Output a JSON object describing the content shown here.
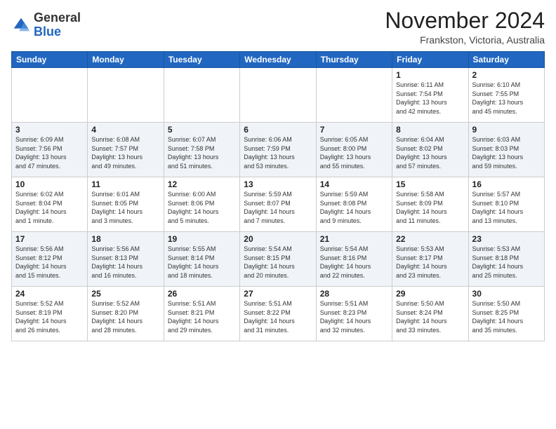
{
  "logo": {
    "general": "General",
    "blue": "Blue"
  },
  "header": {
    "month": "November 2024",
    "location": "Frankston, Victoria, Australia"
  },
  "weekdays": [
    "Sunday",
    "Monday",
    "Tuesday",
    "Wednesday",
    "Thursday",
    "Friday",
    "Saturday"
  ],
  "weeks": [
    [
      {
        "day": "",
        "info": ""
      },
      {
        "day": "",
        "info": ""
      },
      {
        "day": "",
        "info": ""
      },
      {
        "day": "",
        "info": ""
      },
      {
        "day": "",
        "info": ""
      },
      {
        "day": "1",
        "info": "Sunrise: 6:11 AM\nSunset: 7:54 PM\nDaylight: 13 hours\nand 42 minutes."
      },
      {
        "day": "2",
        "info": "Sunrise: 6:10 AM\nSunset: 7:55 PM\nDaylight: 13 hours\nand 45 minutes."
      }
    ],
    [
      {
        "day": "3",
        "info": "Sunrise: 6:09 AM\nSunset: 7:56 PM\nDaylight: 13 hours\nand 47 minutes."
      },
      {
        "day": "4",
        "info": "Sunrise: 6:08 AM\nSunset: 7:57 PM\nDaylight: 13 hours\nand 49 minutes."
      },
      {
        "day": "5",
        "info": "Sunrise: 6:07 AM\nSunset: 7:58 PM\nDaylight: 13 hours\nand 51 minutes."
      },
      {
        "day": "6",
        "info": "Sunrise: 6:06 AM\nSunset: 7:59 PM\nDaylight: 13 hours\nand 53 minutes."
      },
      {
        "day": "7",
        "info": "Sunrise: 6:05 AM\nSunset: 8:00 PM\nDaylight: 13 hours\nand 55 minutes."
      },
      {
        "day": "8",
        "info": "Sunrise: 6:04 AM\nSunset: 8:02 PM\nDaylight: 13 hours\nand 57 minutes."
      },
      {
        "day": "9",
        "info": "Sunrise: 6:03 AM\nSunset: 8:03 PM\nDaylight: 13 hours\nand 59 minutes."
      }
    ],
    [
      {
        "day": "10",
        "info": "Sunrise: 6:02 AM\nSunset: 8:04 PM\nDaylight: 14 hours\nand 1 minute."
      },
      {
        "day": "11",
        "info": "Sunrise: 6:01 AM\nSunset: 8:05 PM\nDaylight: 14 hours\nand 3 minutes."
      },
      {
        "day": "12",
        "info": "Sunrise: 6:00 AM\nSunset: 8:06 PM\nDaylight: 14 hours\nand 5 minutes."
      },
      {
        "day": "13",
        "info": "Sunrise: 5:59 AM\nSunset: 8:07 PM\nDaylight: 14 hours\nand 7 minutes."
      },
      {
        "day": "14",
        "info": "Sunrise: 5:59 AM\nSunset: 8:08 PM\nDaylight: 14 hours\nand 9 minutes."
      },
      {
        "day": "15",
        "info": "Sunrise: 5:58 AM\nSunset: 8:09 PM\nDaylight: 14 hours\nand 11 minutes."
      },
      {
        "day": "16",
        "info": "Sunrise: 5:57 AM\nSunset: 8:10 PM\nDaylight: 14 hours\nand 13 minutes."
      }
    ],
    [
      {
        "day": "17",
        "info": "Sunrise: 5:56 AM\nSunset: 8:12 PM\nDaylight: 14 hours\nand 15 minutes."
      },
      {
        "day": "18",
        "info": "Sunrise: 5:56 AM\nSunset: 8:13 PM\nDaylight: 14 hours\nand 16 minutes."
      },
      {
        "day": "19",
        "info": "Sunrise: 5:55 AM\nSunset: 8:14 PM\nDaylight: 14 hours\nand 18 minutes."
      },
      {
        "day": "20",
        "info": "Sunrise: 5:54 AM\nSunset: 8:15 PM\nDaylight: 14 hours\nand 20 minutes."
      },
      {
        "day": "21",
        "info": "Sunrise: 5:54 AM\nSunset: 8:16 PM\nDaylight: 14 hours\nand 22 minutes."
      },
      {
        "day": "22",
        "info": "Sunrise: 5:53 AM\nSunset: 8:17 PM\nDaylight: 14 hours\nand 23 minutes."
      },
      {
        "day": "23",
        "info": "Sunrise: 5:53 AM\nSunset: 8:18 PM\nDaylight: 14 hours\nand 25 minutes."
      }
    ],
    [
      {
        "day": "24",
        "info": "Sunrise: 5:52 AM\nSunset: 8:19 PM\nDaylight: 14 hours\nand 26 minutes."
      },
      {
        "day": "25",
        "info": "Sunrise: 5:52 AM\nSunset: 8:20 PM\nDaylight: 14 hours\nand 28 minutes."
      },
      {
        "day": "26",
        "info": "Sunrise: 5:51 AM\nSunset: 8:21 PM\nDaylight: 14 hours\nand 29 minutes."
      },
      {
        "day": "27",
        "info": "Sunrise: 5:51 AM\nSunset: 8:22 PM\nDaylight: 14 hours\nand 31 minutes."
      },
      {
        "day": "28",
        "info": "Sunrise: 5:51 AM\nSunset: 8:23 PM\nDaylight: 14 hours\nand 32 minutes."
      },
      {
        "day": "29",
        "info": "Sunrise: 5:50 AM\nSunset: 8:24 PM\nDaylight: 14 hours\nand 33 minutes."
      },
      {
        "day": "30",
        "info": "Sunrise: 5:50 AM\nSunset: 8:25 PM\nDaylight: 14 hours\nand 35 minutes."
      }
    ]
  ]
}
